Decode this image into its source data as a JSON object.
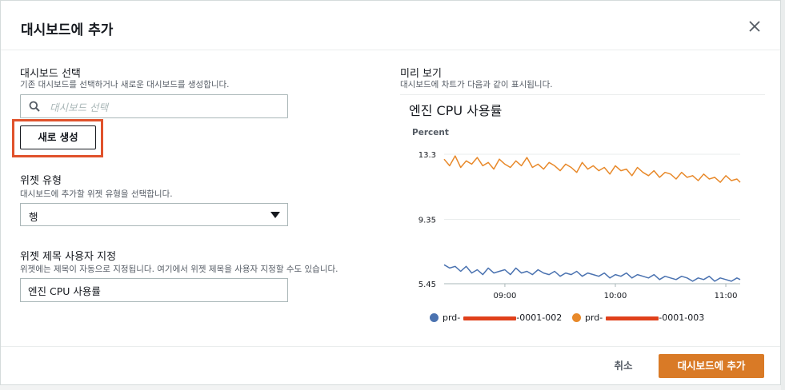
{
  "modal": {
    "title": "대시보드에 추가",
    "close_icon": "close-icon"
  },
  "dashboard_select": {
    "title": "대시보드 선택",
    "description": "기존 대시보드를 선택하거나 새로운 대시보드를 생성합니다.",
    "search_placeholder": "대시보드 선택",
    "search_value": "",
    "new_button_label": "새로 생성"
  },
  "widget_type": {
    "title": "위젯 유형",
    "description": "대시보드에 추가할 위젯 유형을 선택합니다.",
    "selected_value": "행"
  },
  "widget_title": {
    "title": "위젯 제목 사용자 지정",
    "description": "위젯에는 제목이 자동으로 지정됩니다. 여기에서 위젯 제목을 사용자 지정할 수도 있습니다.",
    "value": "엔진 CPU 사용률"
  },
  "preview": {
    "title": "미리 보기",
    "description": "대시보드에 차트가 다음과 같이 표시됩니다."
  },
  "chart_data": {
    "type": "line",
    "title": "엔진 CPU 사용률",
    "ylabel": "Percent",
    "ylim": [
      5.45,
      13.3
    ],
    "y_ticks": [
      "13.3",
      "9.35",
      "5.45"
    ],
    "x_ticks": [
      "09:00",
      "10:00",
      "11:00"
    ],
    "x_tick_values": [
      9.0,
      10.0,
      11.0
    ],
    "xlim": [
      8.45,
      11.13
    ],
    "grid": true,
    "legend_position": "bottom",
    "series": [
      {
        "name": "prd-",
        "name_suffix": "-0001-002",
        "color": "#4a72b0",
        "x": [
          8.45,
          8.5,
          8.55,
          8.6,
          8.65,
          8.7,
          8.75,
          8.8,
          8.85,
          8.9,
          8.95,
          9.0,
          9.05,
          9.1,
          9.15,
          9.2,
          9.25,
          9.3,
          9.35,
          9.4,
          9.45,
          9.5,
          9.55,
          9.6,
          9.65,
          9.7,
          9.75,
          9.8,
          9.85,
          9.9,
          9.95,
          10.0,
          10.05,
          10.1,
          10.15,
          10.2,
          10.25,
          10.3,
          10.35,
          10.4,
          10.45,
          10.5,
          10.55,
          10.6,
          10.65,
          10.7,
          10.75,
          10.8,
          10.85,
          10.9,
          10.95,
          11.0,
          11.05,
          11.1,
          11.13
        ],
        "y": [
          6.6,
          6.4,
          6.5,
          6.2,
          6.5,
          6.1,
          6.3,
          6.0,
          6.4,
          6.1,
          6.2,
          6.3,
          6.0,
          6.4,
          6.1,
          6.2,
          6.0,
          6.3,
          6.1,
          6.0,
          6.2,
          5.9,
          6.1,
          6.0,
          6.2,
          5.9,
          6.1,
          6.0,
          5.9,
          6.1,
          5.8,
          6.0,
          5.9,
          6.1,
          5.8,
          6.0,
          5.9,
          5.8,
          6.0,
          5.7,
          5.9,
          5.8,
          5.7,
          5.9,
          5.8,
          5.6,
          5.8,
          5.7,
          5.9,
          5.6,
          5.8,
          5.7,
          5.6,
          5.8,
          5.7
        ]
      },
      {
        "name": "prd-",
        "name_suffix": "-0001-003",
        "color": "#e8892a",
        "x": [
          8.45,
          8.5,
          8.55,
          8.6,
          8.65,
          8.7,
          8.75,
          8.8,
          8.85,
          8.9,
          8.95,
          9.0,
          9.05,
          9.1,
          9.15,
          9.2,
          9.25,
          9.3,
          9.35,
          9.4,
          9.45,
          9.5,
          9.55,
          9.6,
          9.65,
          9.7,
          9.75,
          9.8,
          9.85,
          9.9,
          9.95,
          10.0,
          10.05,
          10.1,
          10.15,
          10.2,
          10.25,
          10.3,
          10.35,
          10.4,
          10.45,
          10.5,
          10.55,
          10.6,
          10.65,
          10.7,
          10.75,
          10.8,
          10.85,
          10.9,
          10.95,
          11.0,
          11.05,
          11.1,
          11.13
        ],
        "y": [
          13.0,
          12.6,
          13.2,
          12.5,
          12.9,
          12.7,
          13.1,
          12.6,
          12.8,
          12.4,
          13.0,
          12.7,
          12.5,
          12.9,
          12.6,
          13.1,
          12.5,
          12.7,
          12.4,
          12.8,
          12.6,
          12.3,
          12.7,
          12.5,
          12.2,
          12.8,
          12.4,
          12.6,
          12.3,
          12.5,
          12.1,
          12.6,
          12.3,
          12.4,
          12.0,
          12.5,
          12.2,
          12.0,
          12.3,
          11.9,
          12.2,
          12.1,
          11.8,
          12.2,
          11.9,
          12.0,
          11.7,
          12.1,
          11.8,
          11.9,
          11.6,
          12.0,
          11.7,
          11.8,
          11.6
        ]
      }
    ]
  },
  "footer": {
    "cancel_label": "취소",
    "add_label": "대시보드에 추가"
  },
  "colors": {
    "accent": "#d97a26",
    "highlight": "#e0522c",
    "series_1": "#4a72b0",
    "series_2": "#e8892a",
    "redaction": "#e0401a"
  }
}
